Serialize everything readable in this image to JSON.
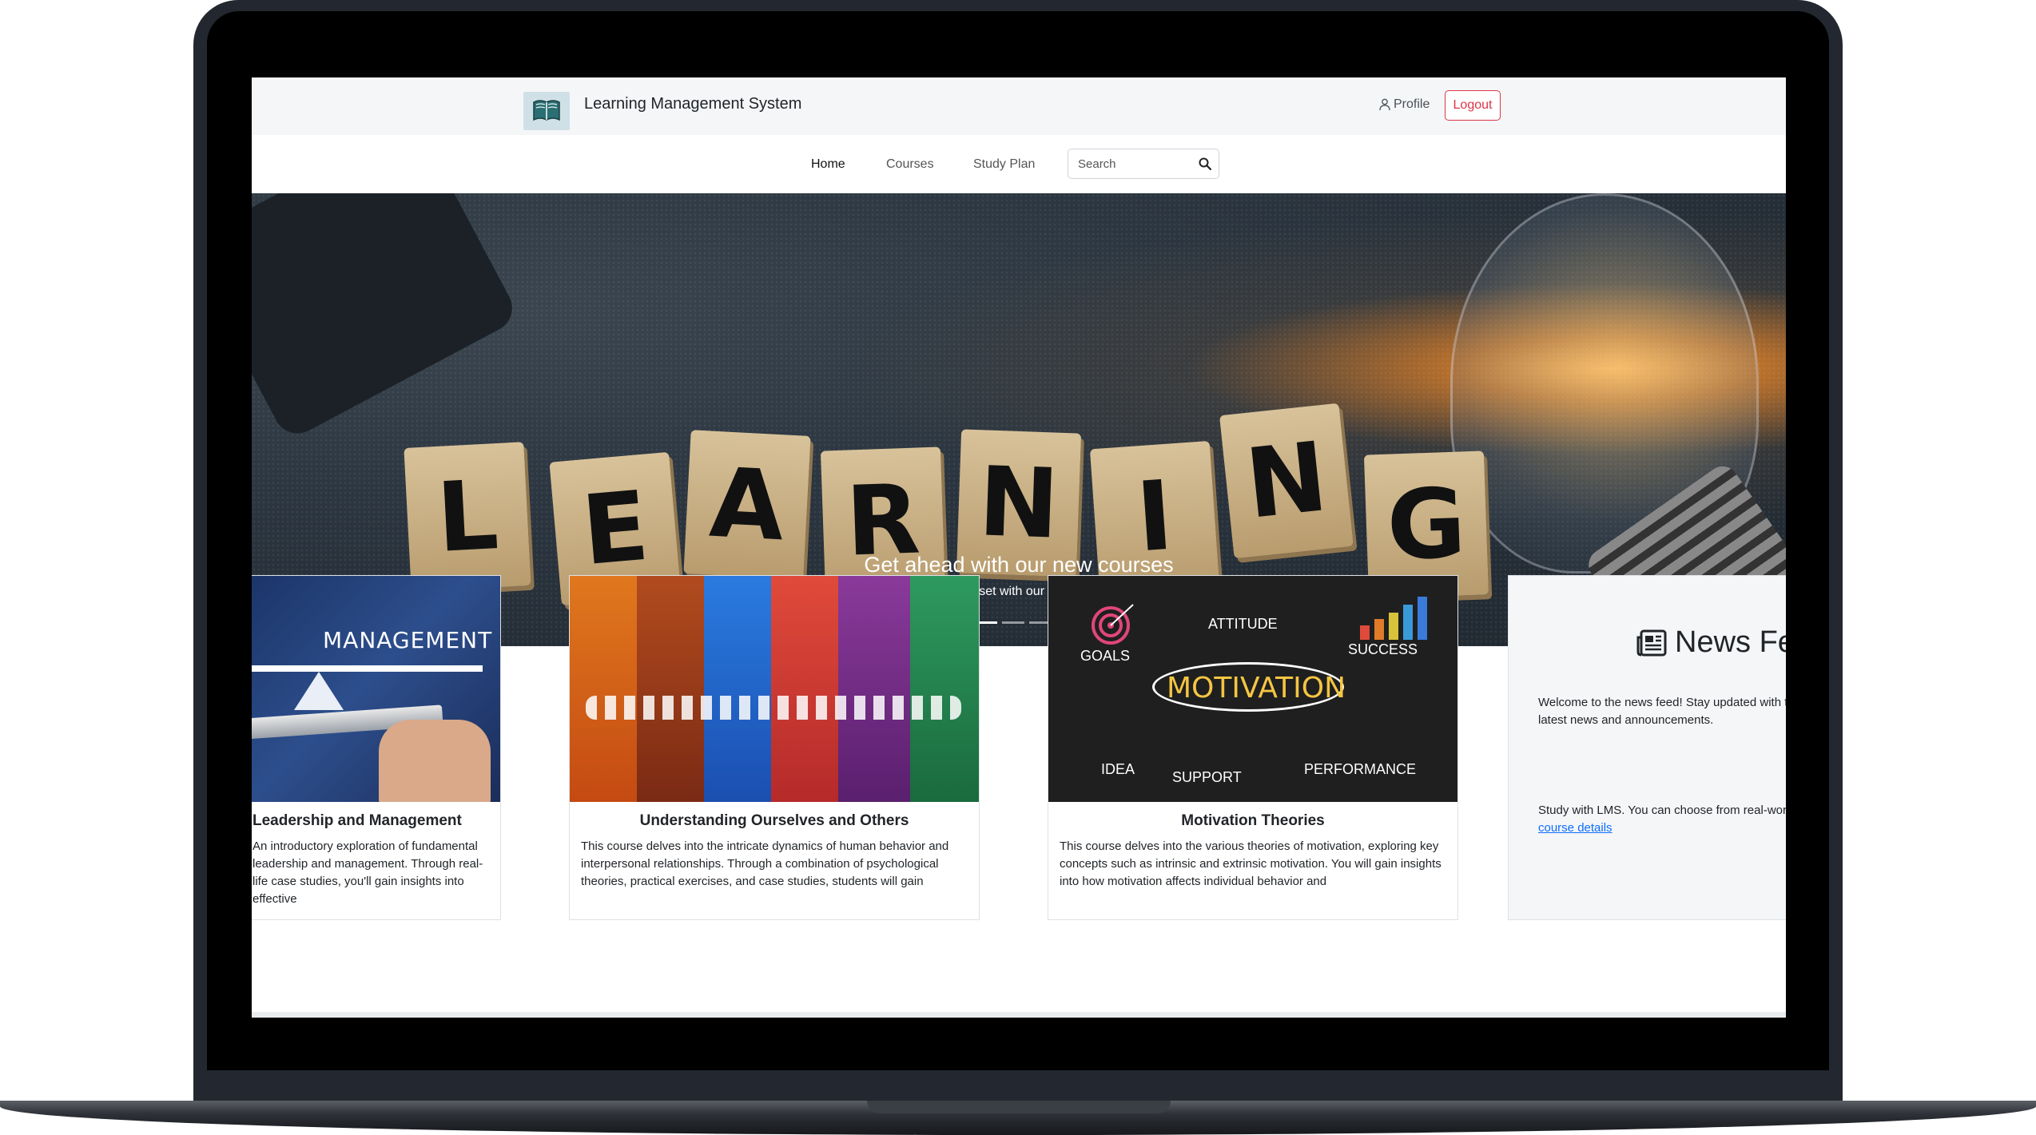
{
  "header": {
    "brand": "Learning Management System",
    "profile_label": "Profile",
    "logout_label": "Logout"
  },
  "nav": {
    "items": [
      "Home",
      "Courses",
      "Study Plan"
    ],
    "search_placeholder": "Search"
  },
  "hero": {
    "letters": [
      "L",
      "E",
      "A",
      "R",
      "N",
      "I",
      "N",
      "G"
    ],
    "title": "Get ahead with our new courses",
    "subtitle": "Enhance your skillset with our latest short courses.",
    "slides": 3,
    "active_slide": 0
  },
  "courses": [
    {
      "image_text": "MANAGEMENT",
      "title": "Leadership and Management",
      "description": "An introductory exploration of fundamental leadership and management. Through real-life case studies, you'll gain insights into effective"
    },
    {
      "title": "Understanding Ourselves and Others",
      "description": "This course delves into the intricate dynamics of human behavior and interpersonal relationships. Through a combination of psychological theories, practical exercises, and case studies, students will gain"
    },
    {
      "image_words": [
        "ATTITUDE",
        "GOALS",
        "SUCCESS",
        "MOTIVATION",
        "IDEA",
        "SUPPORT",
        "PERFORMANCE"
      ],
      "title": "Motivation Theories",
      "description": "This course delves into the various theories of motivation, exploring key concepts such as intrinsic and extrinsic motivation. You will gain insights into how motivation affects individual behavior and"
    }
  ],
  "news_feed": {
    "title": "News Feed",
    "welcome": "Welcome to the news feed! Stay updated with the latest news and announcements.",
    "study_text": "Study with LMS. You can choose from real-world",
    "link_text": "course details"
  },
  "colors": {
    "logout": "#dc3545",
    "link": "#0d6efd",
    "topbar": "#f5f6f8",
    "motivation_text": "#f5c542"
  }
}
